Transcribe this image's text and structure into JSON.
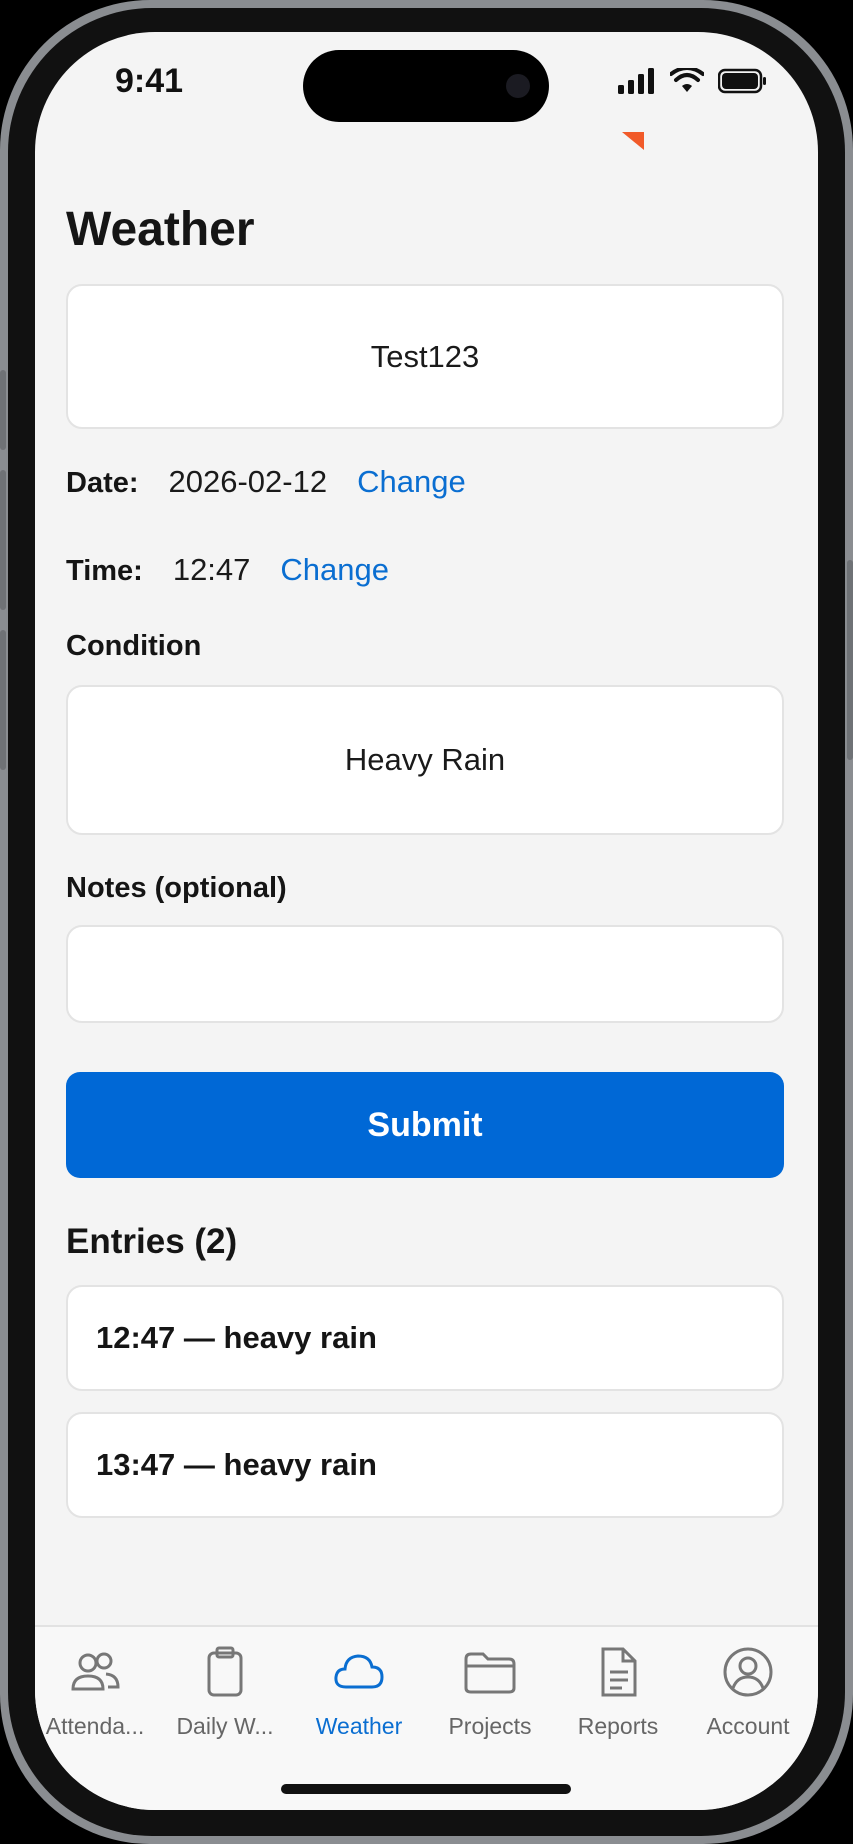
{
  "status_bar": {
    "time": "9:41"
  },
  "page": {
    "title": "Weather"
  },
  "project": {
    "value": "Test123"
  },
  "date": {
    "label": "Date:",
    "value": "2026-02-12",
    "change_label": "Change"
  },
  "time": {
    "label": "Time:",
    "value": "12:47",
    "change_label": "Change"
  },
  "condition": {
    "label": "Condition",
    "value": "Heavy Rain"
  },
  "notes": {
    "label": "Notes (optional)",
    "value": "",
    "placeholder": ""
  },
  "submit": {
    "label": "Submit"
  },
  "entries": {
    "title": "Entries (2)",
    "items": [
      {
        "text": "12:47 — heavy rain"
      },
      {
        "text": "13:47 — heavy rain"
      }
    ]
  },
  "tabbar": {
    "items": [
      {
        "label": "Attenda...",
        "icon": "people-icon"
      },
      {
        "label": "Daily W...",
        "icon": "clipboard-icon"
      },
      {
        "label": "Weather",
        "icon": "cloud-icon",
        "active": true
      },
      {
        "label": "Projects",
        "icon": "folder-icon"
      },
      {
        "label": "Reports",
        "icon": "document-icon"
      },
      {
        "label": "Account",
        "icon": "user-circle-icon"
      }
    ]
  },
  "colors": {
    "accent": "#0068d6",
    "link": "#0a6ed1",
    "background": "#f4f4f4"
  }
}
